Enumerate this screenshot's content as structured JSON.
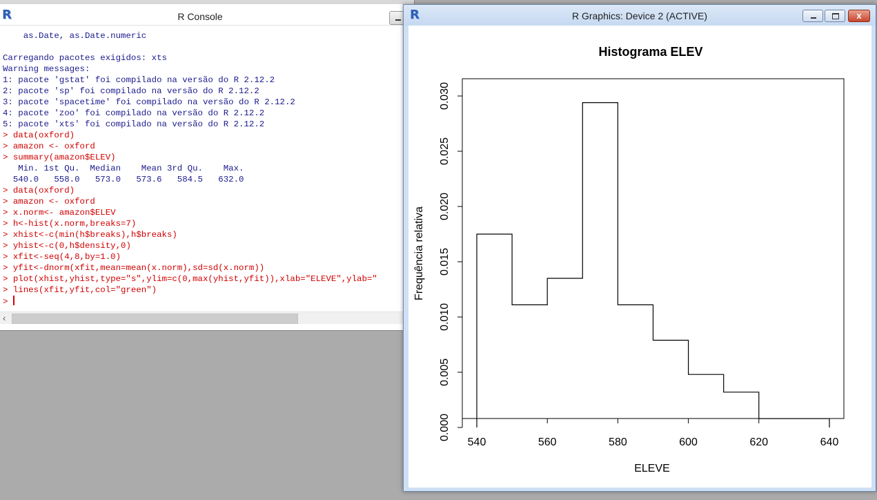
{
  "console": {
    "title": "R Console",
    "lines": [
      {
        "type": "out",
        "text": "    as.Date, as.Date.numeric"
      },
      {
        "type": "out",
        "text": ""
      },
      {
        "type": "out",
        "text": "Carregando pacotes exigidos: xts"
      },
      {
        "type": "out",
        "text": "Warning messages:"
      },
      {
        "type": "out",
        "text": "1: pacote 'gstat' foi compilado na versão do R 2.12.2"
      },
      {
        "type": "out",
        "text": "2: pacote 'sp' foi compilado na versão do R 2.12.2"
      },
      {
        "type": "out",
        "text": "3: pacote 'spacetime' foi compilado na versão do R 2.12.2"
      },
      {
        "type": "out",
        "text": "4: pacote 'zoo' foi compilado na versão do R 2.12.2"
      },
      {
        "type": "out",
        "text": "5: pacote 'xts' foi compilado na versão do R 2.12.2"
      },
      {
        "type": "cmd",
        "text": "> data(oxford)"
      },
      {
        "type": "cmd",
        "text": "> amazon <- oxford"
      },
      {
        "type": "cmd",
        "text": "> summary(amazon$ELEV)"
      },
      {
        "type": "out",
        "text": "   Min. 1st Qu.  Median    Mean 3rd Qu.    Max."
      },
      {
        "type": "out",
        "text": "  540.0   558.0   573.0   573.6   584.5   632.0"
      },
      {
        "type": "cmd",
        "text": "> data(oxford)"
      },
      {
        "type": "cmd",
        "text": "> amazon <- oxford"
      },
      {
        "type": "cmd",
        "text": "> x.norm<- amazon$ELEV"
      },
      {
        "type": "cmd",
        "text": "> h<-hist(x.norm,breaks=7)"
      },
      {
        "type": "cmd",
        "text": "> xhist<-c(min(h$breaks),h$breaks)"
      },
      {
        "type": "cmd",
        "text": "> yhist<-c(0,h$density,0)"
      },
      {
        "type": "cmd",
        "text": "> xfit<-seq(4,8,by=1.0)"
      },
      {
        "type": "cmd",
        "text": "> yfit<-dnorm(xfit,mean=mean(x.norm),sd=sd(x.norm))"
      },
      {
        "type": "cmd",
        "text": "> plot(xhist,yhist,type=\"s\",ylim=c(0,max(yhist,yfit)),xlab=\"ELEVE\",ylab=\""
      },
      {
        "type": "cmd",
        "text": "> lines(xfit,yfit,col=\"green\")"
      }
    ],
    "prompt": "> "
  },
  "graphics": {
    "title": "R Graphics: Device 2 (ACTIVE)",
    "close_glyph": "x"
  },
  "chart_data": {
    "type": "line",
    "style": "step",
    "title": "Histograma ELEV",
    "xlabel": "ELEVE",
    "ylabel": "Frequência relativa",
    "xlim": [
      540,
      640
    ],
    "ylim": [
      0,
      0.03
    ],
    "xticks": [
      540,
      560,
      580,
      600,
      620,
      640
    ],
    "yticks": [
      0.0,
      0.005,
      0.01,
      0.015,
      0.02,
      0.025,
      0.03
    ],
    "ytick_labels": [
      "0.000",
      "0.005",
      "0.010",
      "0.015",
      "0.020",
      "0.025",
      "0.030"
    ],
    "xtick_labels": [
      "540",
      "560",
      "580",
      "600",
      "620",
      "640"
    ],
    "x": [
      540,
      540,
      550,
      560,
      570,
      580,
      590,
      600,
      610,
      620,
      630,
      640
    ],
    "y": [
      0,
      0.0175,
      0.0111,
      0.0135,
      0.0294,
      0.0111,
      0.0079,
      0.0048,
      0.0032,
      0.0008,
      0.0008,
      0
    ],
    "color": "#000000",
    "grid": false
  }
}
